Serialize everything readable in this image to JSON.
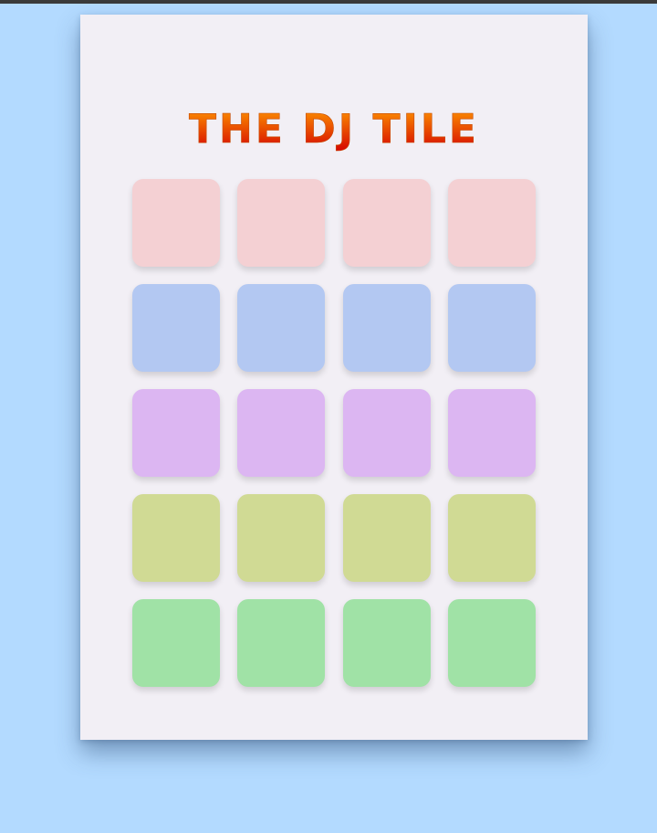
{
  "app": {
    "title": "THE DJ TILE"
  },
  "colors": {
    "page_background": "#b3daff",
    "card_background": "#f2eff5",
    "title_gradient_top": "#ff9a00",
    "title_gradient_bottom": "#d40000"
  },
  "pad_rows": [
    {
      "color": "#f4d0d3"
    },
    {
      "color": "#b3c8f2"
    },
    {
      "color": "#dcb6f2"
    },
    {
      "color": "#d0da94"
    },
    {
      "color": "#a0e2a6"
    }
  ]
}
